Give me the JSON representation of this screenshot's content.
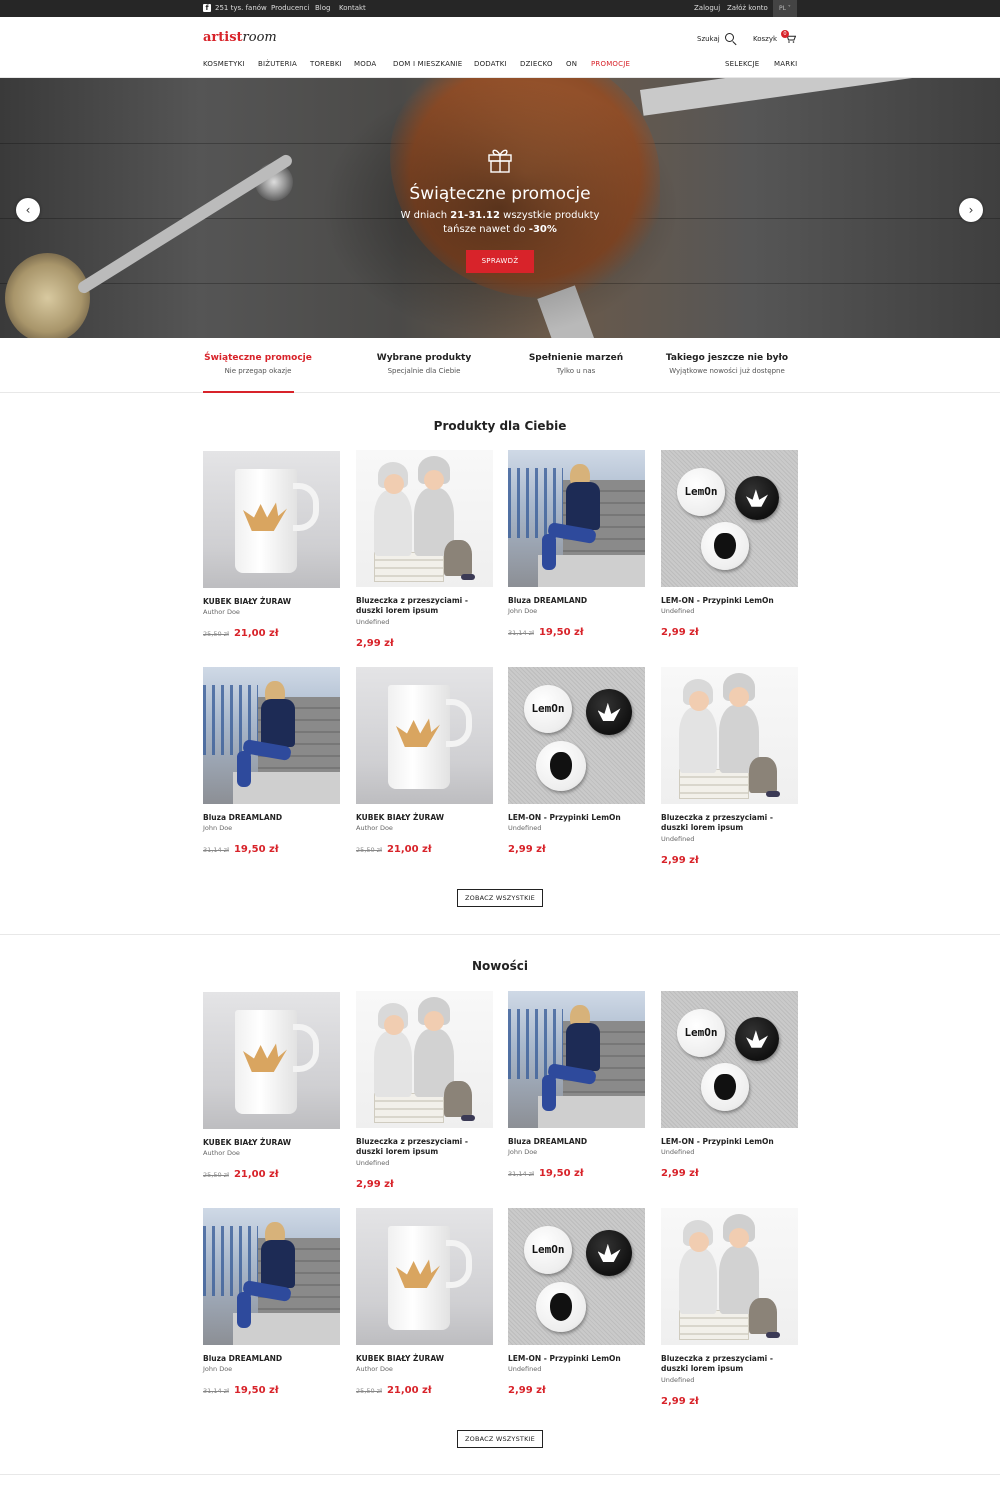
{
  "topbar": {
    "fb_fans": "251 tys. fanów",
    "links": [
      "Producenci",
      "Blog",
      "Kontakt"
    ],
    "login": "Zaloguj",
    "register": "Załóż konto",
    "lang": "PL"
  },
  "header": {
    "logo_part1": "artist",
    "logo_part2": "room",
    "search_label": "Szukaj",
    "cart_label": "Koszyk",
    "cart_count": "0"
  },
  "nav": {
    "items": [
      "KOSMETYKI",
      "BIŻUTERIA",
      "TOREBKI",
      "MODA",
      "DOM I MIESZKANIE",
      "DODATKI",
      "DZIECKO",
      "ON",
      "PROMOCJE"
    ],
    "right": [
      "SELEKCJE",
      "MARKI"
    ]
  },
  "hero": {
    "title": "Świąteczne promocje",
    "line1_pre": "W dniach ",
    "line1_bold": "21-31.12",
    "line1_post": " wszystkie produkty",
    "line2_pre": "tańsze nawet do ",
    "line2_bold": "-30%",
    "button": "SPRAWDŹ",
    "prev": "‹",
    "next": "›"
  },
  "tabs": [
    {
      "title": "Świąteczne promocje",
      "subtitle": "Nie przegap okazje"
    },
    {
      "title": "Wybrane produkty",
      "subtitle": "Specjalnie dla Ciebie"
    },
    {
      "title": "Spełnienie marzeń",
      "subtitle": "Tylko u nas"
    },
    {
      "title": "Takiego jeszcze nie było",
      "subtitle": "Wyjątkowe nowości już dostępne"
    }
  ],
  "section1": {
    "title": "Produkty dla Ciebie",
    "button": "ZOBACZ WSZYSTKIE",
    "products": [
      {
        "name": "KUBEK BIAŁY ŻURAW",
        "author": "Author Doe",
        "old": "25,50 zł",
        "price": "21,00 zł"
      },
      {
        "name": "Bluzeczka z przeszyciami - duszki lorem ipsum",
        "author": "Undefined",
        "old": "",
        "price": "2,99 zł"
      },
      {
        "name": "Bluza DREAMLAND",
        "author": "John Doe",
        "old": "31,14 zł",
        "price": "19,50 zł"
      },
      {
        "name": "LEM-ON - Przypinki LemOn",
        "author": "Undefined",
        "old": "",
        "price": "2,99 zł"
      },
      {
        "name": "Bluza DREAMLAND",
        "author": "John Doe",
        "old": "31,14 zł",
        "price": "19,50 zł"
      },
      {
        "name": "KUBEK BIAŁY ŻURAW",
        "author": "Author Doe",
        "old": "25,50 zł",
        "price": "21,00 zł"
      },
      {
        "name": "LEM-ON - Przypinki LemOn",
        "author": "Undefined",
        "old": "",
        "price": "2,99 zł"
      },
      {
        "name": "Bluzeczka z przeszyciami - duszki lorem ipsum",
        "author": "Undefined",
        "old": "",
        "price": "2,99 zł"
      }
    ]
  },
  "section2": {
    "title": "Nowości",
    "button": "ZOBACZ WSZYSTKIE",
    "products": [
      {
        "name": "KUBEK BIAŁY ŻURAW",
        "author": "Author Doe",
        "old": "25,50 zł",
        "price": "21,00 zł"
      },
      {
        "name": "Bluzeczka z przeszyciami - duszki lorem ipsum",
        "author": "Undefined",
        "old": "",
        "price": "2,99 zł"
      },
      {
        "name": "Bluza DREAMLAND",
        "author": "John Doe",
        "old": "31,14 zł",
        "price": "19,50 zł"
      },
      {
        "name": "LEM-ON - Przypinki LemOn",
        "author": "Undefined",
        "old": "",
        "price": "2,99 zł"
      },
      {
        "name": "Bluza DREAMLAND",
        "author": "John Doe",
        "old": "31,14 zł",
        "price": "19,50 zł"
      },
      {
        "name": "KUBEK BIAŁY ŻURAW",
        "author": "Author Doe",
        "old": "25,50 zł",
        "price": "21,00 zł"
      },
      {
        "name": "LEM-ON - Przypinki LemOn",
        "author": "Undefined",
        "old": "",
        "price": "2,99 zł"
      },
      {
        "name": "Bluzeczka z przeszyciami - duszki lorem ipsum",
        "author": "Undefined",
        "old": "",
        "price": "2,99 zł"
      }
    ]
  },
  "image_text": {
    "pin_logo": "LemOn"
  },
  "colors": {
    "accent": "#d8232a",
    "topbar": "#262626"
  }
}
